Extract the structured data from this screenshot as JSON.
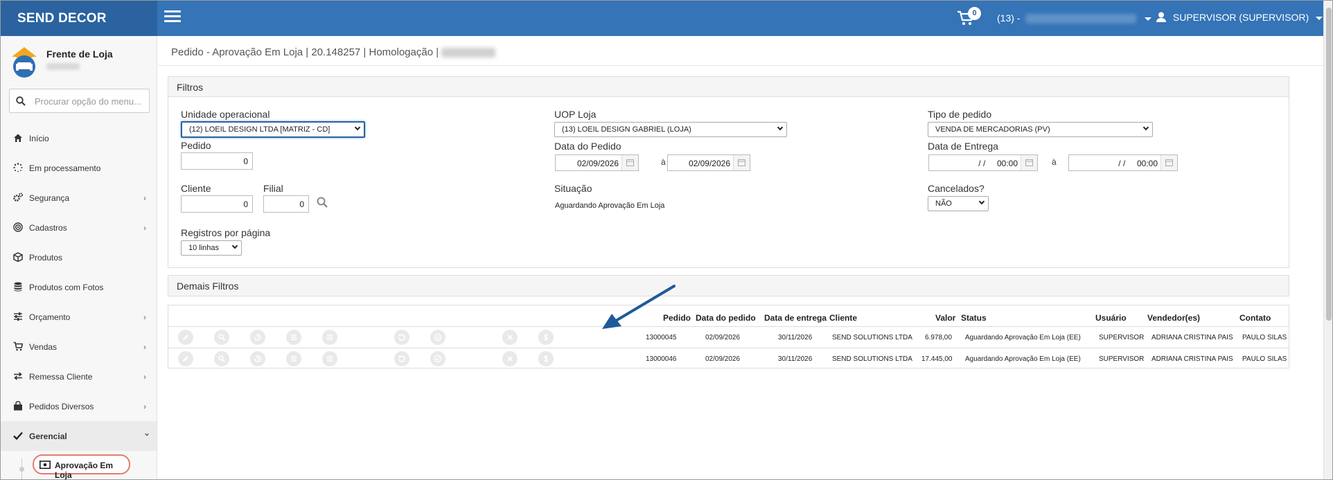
{
  "header": {
    "brand": "SEND DECOR",
    "cart_count": "0",
    "store_label": "(13) -",
    "user_label": "SUPERVISOR (SUPERVISOR)"
  },
  "sidebar": {
    "store_name": "Frente de Loja",
    "search_placeholder": "Procurar opção do menu...",
    "items": [
      {
        "label": "Início",
        "icon": "home-icon",
        "chevron": ""
      },
      {
        "label": "Em processamento",
        "icon": "spinner-icon",
        "chevron": ""
      },
      {
        "label": "Segurança",
        "icon": "gears-icon",
        "chevron": "›"
      },
      {
        "label": "Cadastros",
        "icon": "target-icon",
        "chevron": "›"
      },
      {
        "label": "Produtos",
        "icon": "cube-icon",
        "chevron": ""
      },
      {
        "label": "Produtos com Fotos",
        "icon": "database-icon",
        "chevron": ""
      },
      {
        "label": "Orçamento",
        "icon": "sliders-icon",
        "chevron": "›"
      },
      {
        "label": "Vendas",
        "icon": "cart-icon",
        "chevron": "›"
      },
      {
        "label": "Remessa Cliente",
        "icon": "exchange-icon",
        "chevron": "›"
      },
      {
        "label": "Pedidos Diversos",
        "icon": "bag-icon",
        "chevron": "›"
      },
      {
        "label": "Gerencial",
        "icon": "check-icon",
        "chevron": "⌄"
      }
    ],
    "active_sub": "Aprovação Em Loja"
  },
  "page": {
    "title": "Pedido - Aprovação Em Loja | 20.148257 | Homologação |"
  },
  "filters": {
    "heading": "Filtros",
    "unidade_label": "Unidade operacional",
    "unidade_value": "(12) LOEIL DESIGN LTDA [MATRIZ - CD]",
    "uop_label": "UOP Loja",
    "uop_value": "(13) LOEIL DESIGN GABRIEL (LOJA)",
    "tipo_label": "Tipo de pedido",
    "tipo_value": "VENDA DE MERCADORIAS (PV)",
    "pedido_label": "Pedido",
    "pedido_value": "0",
    "data_pedido_label": "Data do Pedido",
    "data_pedido_from": "02/09/2026",
    "data_pedido_to": "02/09/2026",
    "range_sep": "à",
    "data_entrega_label": "Data de Entrega",
    "data_entrega_from": "/ /     00:00",
    "data_entrega_to": "/ /     00:00",
    "cliente_label": "Cliente",
    "cliente_value": "0",
    "filial_label": "Filial",
    "filial_value": "0",
    "situacao_label": "Situação",
    "situacao_value": "Aguardando Aprovação Em Loja",
    "cancelados_label": "Cancelados?",
    "cancelados_value": "NÃO",
    "registros_label": "Registros por página",
    "registros_value": "10 linhas"
  },
  "demais": {
    "heading": "Demais Filtros"
  },
  "table": {
    "headers": {
      "pedido": "Pedido",
      "data_pedido": "Data do pedido",
      "data_entrega": "Data de entrega",
      "cliente": "Cliente",
      "valor": "Valor",
      "status": "Status",
      "usuario": "Usuário",
      "vendedor": "Vendedor(es)",
      "contato": "Contato"
    },
    "rows": [
      {
        "pedido": "13000045",
        "data_pedido": "02/09/2026",
        "data_entrega": "30/11/2026",
        "cliente": "SEND SOLUTIONS LTDA",
        "valor": "6.978,00",
        "status": "Aguardando Aprovação Em Loja (EE)",
        "usuario": "SUPERVISOR",
        "vendedor": "ADRIANA CRISTINA PAIS",
        "contato": "PAULO SILAS"
      },
      {
        "pedido": "13000046",
        "data_pedido": "02/09/2026",
        "data_entrega": "30/11/2026",
        "cliente": "SEND SOLUTIONS LTDA",
        "valor": "17.445,00",
        "status": "Aguardando Aprovação Em Loja (EE)",
        "usuario": "SUPERVISOR",
        "vendedor": "ADRIANA CRISTINA PAIS",
        "contato": "PAULO SILAS"
      }
    ]
  },
  "colors": {
    "topbar": "#3474b7",
    "brandbar": "#2a63a0",
    "highlight": "#e37c6f",
    "arrow": "#1f5a9a"
  }
}
